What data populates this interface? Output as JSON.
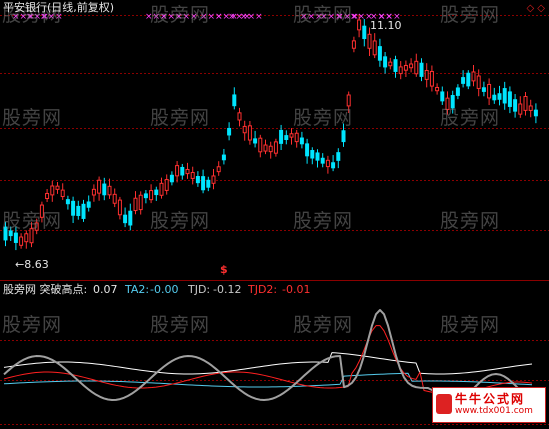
{
  "header": {
    "title": "平安银行(日线,前复权)"
  },
  "price_chart": {
    "high_label": "11.10",
    "low_label": "←8.63",
    "signal_marker": "$",
    "corner_glyph": "◇ ◇"
  },
  "indicator": {
    "name": "股旁网 突破高点:",
    "name_value": "0.07",
    "ta2_label": "TA2:",
    "ta2_value": "-0.00",
    "tjd_label": "TJD:",
    "tjd_value": "-0.12",
    "tjd2_label": "TJD2:",
    "tjd2_value": "-0.01"
  },
  "watermark": {
    "text": "股旁网"
  },
  "site_badge": {
    "name": "牛牛公式网",
    "url": "www.tdx001.com"
  },
  "colors": {
    "up": "#ff3030",
    "down": "#00e5ff",
    "grid": "#8b0000",
    "white_line": "#ffffff",
    "cyan_line": "#55ccee",
    "red_line": "#ff2020",
    "gray_line": "#a0a0a0",
    "marker": "#ff44ff"
  },
  "chart_data": {
    "type": "candlestick",
    "title": "平安银行(日线,前复权)",
    "price_range": [
      8.63,
      11.1
    ]
  }
}
